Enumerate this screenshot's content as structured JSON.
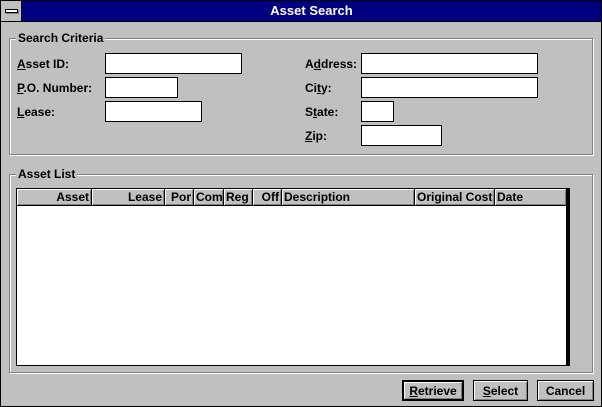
{
  "window": {
    "title": "Asset Search"
  },
  "criteria": {
    "legend": "Search Criteria",
    "asset_id": {
      "accel": "A",
      "rest": "sset ID:",
      "value": ""
    },
    "po_number": {
      "accel": "P",
      "rest": ".O. Number:",
      "value": ""
    },
    "lease": {
      "accel": "L",
      "rest": "ease:",
      "value": ""
    },
    "address": {
      "pre": "A",
      "accel": "d",
      "rest": "dress:",
      "value": ""
    },
    "city": {
      "pre": "Ci",
      "accel": "t",
      "rest": "y:",
      "value": ""
    },
    "state": {
      "pre": "S",
      "accel": "t",
      "rest": "ate:",
      "value": ""
    },
    "zip": {
      "accel": "Z",
      "rest": "ip:",
      "value": ""
    }
  },
  "asset_list": {
    "legend": "Asset List",
    "columns": [
      "Asset",
      "Lease",
      "Por",
      "Com",
      "Reg",
      "Off",
      "Description",
      "Original Cost",
      "Date"
    ],
    "rows": []
  },
  "buttons": {
    "retrieve": {
      "accel": "R",
      "rest": "etrieve"
    },
    "select": {
      "accel": "S",
      "rest": "elect"
    },
    "cancel": {
      "label": "Cancel"
    }
  }
}
